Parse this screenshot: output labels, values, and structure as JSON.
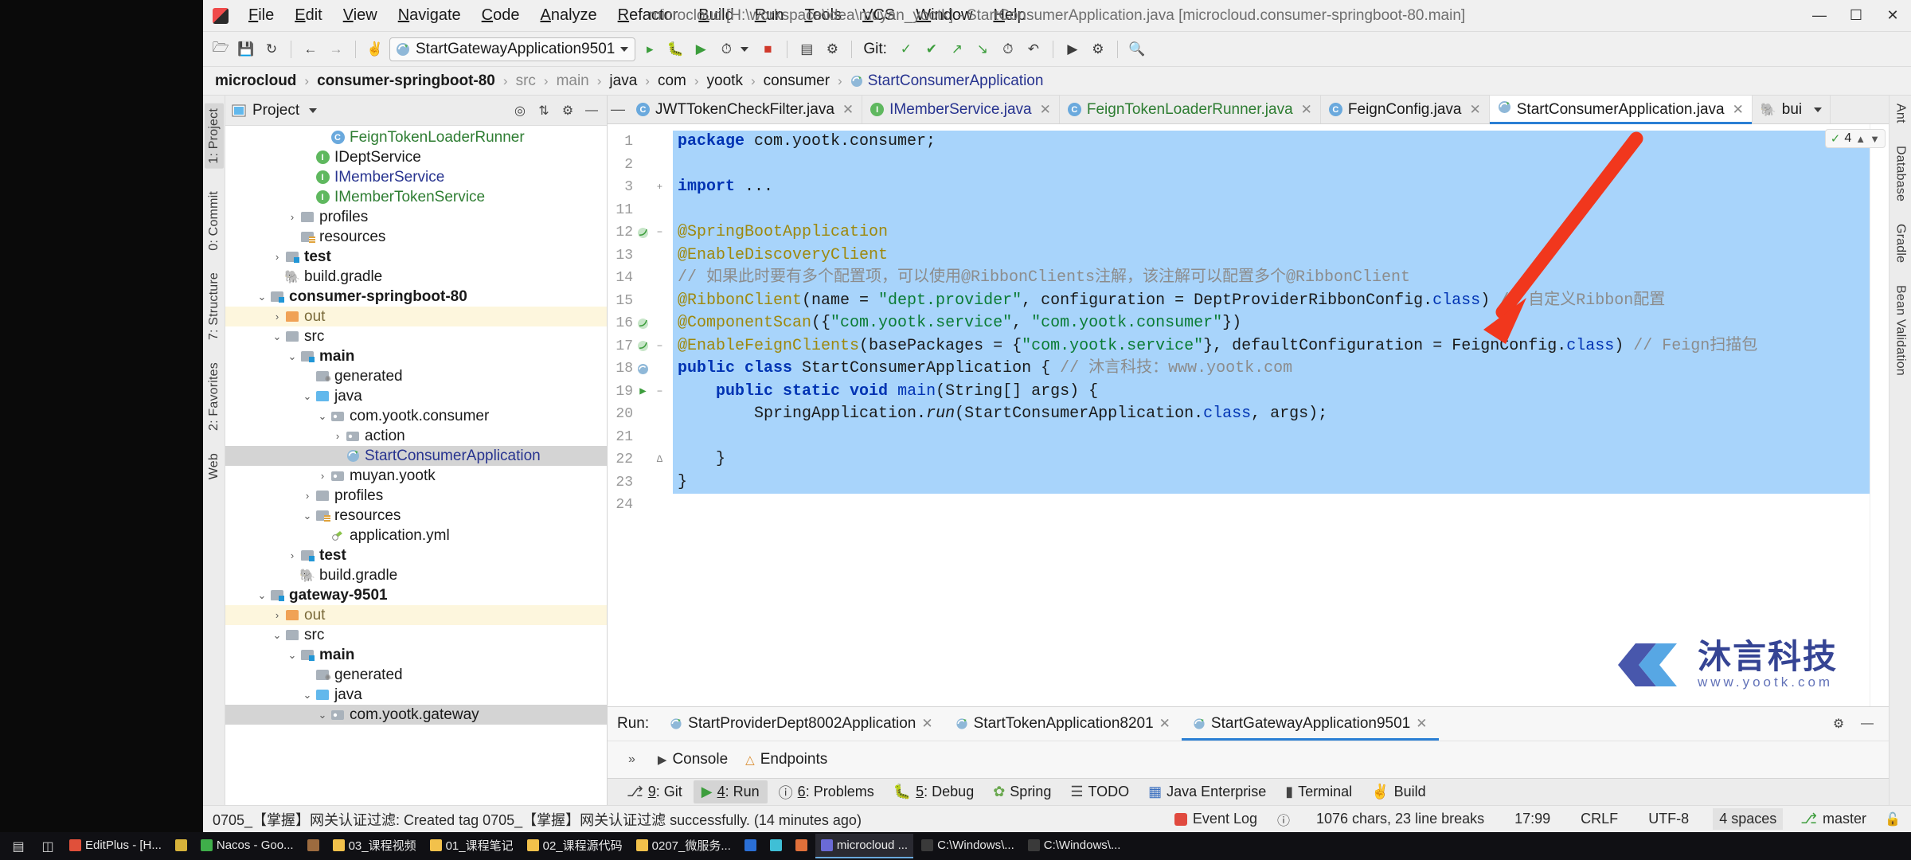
{
  "window": {
    "title": "microcloud [H:\\workspace\\idea\\muyan_yootk] - StartConsumerApplication.java [microcloud.consumer-springboot-80.main]",
    "minimize": "—",
    "maximize": "☐",
    "close": "✕",
    "app_icon": "intellij-idea-icon"
  },
  "menubar": [
    {
      "label": "File"
    },
    {
      "label": "Edit"
    },
    {
      "label": "View"
    },
    {
      "label": "Navigate"
    },
    {
      "label": "Code"
    },
    {
      "label": "Analyze"
    },
    {
      "label": "Refactor"
    },
    {
      "label": "Build"
    },
    {
      "label": "Run"
    },
    {
      "label": "Tools"
    },
    {
      "label": "VCS"
    },
    {
      "label": "Window"
    },
    {
      "label": "Help"
    }
  ],
  "toolbar": {
    "run_config": "StartGatewayApplication9501",
    "git_label": "Git:",
    "icons": [
      "open-folder-icon",
      "save-all-icon",
      "sync-icon",
      "undo-icon",
      "redo-icon",
      "build-hammer-icon",
      "run-icon",
      "debug-icon",
      "run-with-coverage-icon",
      "profile-icon",
      "stop-icon",
      "update-project-icon",
      "commit-icon",
      "push-icon",
      "history-icon",
      "rollback-icon",
      "search-everywhere-icon"
    ]
  },
  "breadcrumb": {
    "items": [
      {
        "label": "microcloud",
        "style": "bold"
      },
      {
        "label": "consumer-springboot-80",
        "style": "bold"
      },
      {
        "label": "src",
        "style": "dim"
      },
      {
        "label": "main",
        "style": "dim"
      },
      {
        "label": "java",
        "style": "normal"
      },
      {
        "label": "com",
        "style": "normal"
      },
      {
        "label": "yootk",
        "style": "normal"
      },
      {
        "label": "consumer",
        "style": "normal"
      },
      {
        "label": "StartConsumerApplication",
        "style": "class"
      }
    ]
  },
  "project_panel": {
    "title": "Project",
    "header_icons": [
      "locate-icon",
      "collapse-all-icon",
      "gear-icon",
      "hide-icon"
    ],
    "tree": [
      {
        "indent": 6,
        "arrow": "",
        "icon": "class-c",
        "label": "FeignTokenLoaderRunner",
        "color": "green",
        "state": "normal"
      },
      {
        "indent": 5,
        "arrow": "",
        "icon": "iface-i",
        "label": "IDeptService",
        "color": "dark",
        "state": "normal"
      },
      {
        "indent": 5,
        "arrow": "",
        "icon": "iface-i",
        "label": "IMemberService",
        "color": "blue",
        "state": "normal"
      },
      {
        "indent": 5,
        "arrow": "",
        "icon": "iface-i",
        "label": "IMemberTokenService",
        "color": "green",
        "state": "normal"
      },
      {
        "indent": 4,
        "arrow": "›",
        "icon": "folder-gray",
        "label": "profiles",
        "color": "dark",
        "state": "normal"
      },
      {
        "indent": 4,
        "arrow": "",
        "icon": "folder-resources",
        "label": "resources",
        "color": "dark",
        "state": "normal"
      },
      {
        "indent": 3,
        "arrow": "›",
        "icon": "folder-src",
        "label": "test",
        "color": "bold",
        "state": "normal"
      },
      {
        "indent": 3,
        "arrow": "",
        "icon": "gradle-elephant",
        "label": "build.gradle",
        "color": "dark",
        "state": "normal"
      },
      {
        "indent": 2,
        "arrow": "⌄",
        "icon": "folder-module",
        "label": "consumer-springboot-80",
        "color": "bold",
        "state": "normal"
      },
      {
        "indent": 3,
        "arrow": "›",
        "icon": "folder-orange",
        "label": "out",
        "color": "tan",
        "state": "highlight"
      },
      {
        "indent": 3,
        "arrow": "⌄",
        "icon": "folder-gray",
        "label": "src",
        "color": "dark",
        "state": "normal"
      },
      {
        "indent": 4,
        "arrow": "⌄",
        "icon": "folder-src",
        "label": "main",
        "color": "bold",
        "state": "normal"
      },
      {
        "indent": 5,
        "arrow": "",
        "icon": "folder-generated",
        "label": "generated",
        "color": "dark",
        "state": "normal"
      },
      {
        "indent": 5,
        "arrow": "⌄",
        "icon": "folder-blue",
        "label": "java",
        "color": "dark",
        "state": "normal"
      },
      {
        "indent": 6,
        "arrow": "⌄",
        "icon": "package-icon",
        "label": "com.yootk.consumer",
        "color": "dark",
        "state": "normal"
      },
      {
        "indent": 7,
        "arrow": "›",
        "icon": "package-icon",
        "label": "action",
        "color": "dark",
        "state": "normal"
      },
      {
        "indent": 7,
        "arrow": "",
        "icon": "spring-class",
        "label": "StartConsumerApplication",
        "color": "blue",
        "state": "selected"
      },
      {
        "indent": 6,
        "arrow": "›",
        "icon": "package-icon",
        "label": "muyan.yootk",
        "color": "dark",
        "state": "normal"
      },
      {
        "indent": 5,
        "arrow": "›",
        "icon": "folder-gray",
        "label": "profiles",
        "color": "dark",
        "state": "normal"
      },
      {
        "indent": 5,
        "arrow": "⌄",
        "icon": "folder-resources",
        "label": "resources",
        "color": "dark",
        "state": "normal"
      },
      {
        "indent": 6,
        "arrow": "",
        "icon": "yml-icon",
        "label": "application.yml",
        "color": "dark",
        "state": "normal"
      },
      {
        "indent": 4,
        "arrow": "›",
        "icon": "folder-src",
        "label": "test",
        "color": "bold",
        "state": "normal"
      },
      {
        "indent": 4,
        "arrow": "",
        "icon": "gradle-elephant",
        "label": "build.gradle",
        "color": "dark",
        "state": "normal"
      },
      {
        "indent": 2,
        "arrow": "⌄",
        "icon": "folder-module",
        "label": "gateway-9501",
        "color": "bold",
        "state": "normal"
      },
      {
        "indent": 3,
        "arrow": "›",
        "icon": "folder-orange",
        "label": "out",
        "color": "tan",
        "state": "highlight"
      },
      {
        "indent": 3,
        "arrow": "⌄",
        "icon": "folder-gray",
        "label": "src",
        "color": "dark",
        "state": "normal"
      },
      {
        "indent": 4,
        "arrow": "⌄",
        "icon": "folder-src",
        "label": "main",
        "color": "bold",
        "state": "normal"
      },
      {
        "indent": 5,
        "arrow": "",
        "icon": "folder-generated",
        "label": "generated",
        "color": "dark",
        "state": "normal"
      },
      {
        "indent": 5,
        "arrow": "⌄",
        "icon": "folder-blue",
        "label": "java",
        "color": "dark",
        "state": "normal"
      },
      {
        "indent": 6,
        "arrow": "⌄",
        "icon": "package-icon",
        "label": "com.yootk.gateway",
        "color": "dark",
        "state": "selected"
      }
    ]
  },
  "editor_tabs": [
    {
      "label": "JWTTokenCheckFilter.java",
      "icon": "class-c",
      "color": "dark",
      "active": false
    },
    {
      "label": "IMemberService.java",
      "icon": "iface-i",
      "color": "blue",
      "active": false
    },
    {
      "label": "FeignTokenLoaderRunner.java",
      "icon": "class-c",
      "color": "green",
      "active": false
    },
    {
      "label": "FeignConfig.java",
      "icon": "class-c",
      "color": "dark",
      "active": false
    },
    {
      "label": "StartConsumerApplication.java",
      "icon": "spring-class",
      "color": "dark",
      "active": true
    },
    {
      "label": "bui",
      "icon": "gradle-elephant",
      "color": "dark",
      "active": false
    }
  ],
  "editor": {
    "inspection_count": "4",
    "inspection_ok": "✓",
    "lines": [
      {
        "num": "1",
        "mark": "",
        "fold": "",
        "html": "<span class='kw'>package</span> com.yootk.consumer;"
      },
      {
        "num": "2",
        "mark": "",
        "fold": "",
        "html": ""
      },
      {
        "num": "3",
        "mark": "",
        "fold": "+",
        "html": "<span class='kw'>import</span> ..."
      },
      {
        "num": "11",
        "mark": "",
        "fold": "",
        "html": ""
      },
      {
        "num": "12",
        "mark": "spring-bean-icon",
        "fold": "−",
        "html": "<span class='ann'>@SpringBootApplication</span>"
      },
      {
        "num": "13",
        "mark": "",
        "fold": "",
        "html": "<span class='ann'>@EnableDiscoveryClient</span>"
      },
      {
        "num": "14",
        "mark": "",
        "fold": "",
        "html": "<span class='cmt'>// 如果此时要有多个配置项，可以使用@RibbonClients注解，该注解可以配置多个@RibbonClient</span>"
      },
      {
        "num": "15",
        "mark": "",
        "fold": "",
        "html": "<span class='ann'>@RibbonClient</span>(name = <span class='str'>\"dept.provider\"</span>, configuration = DeptProviderRibbonConfig.<span class='cls'>class</span>) <span class='cmt'>// 自定义Ribbon配置</span>"
      },
      {
        "num": "16",
        "mark": "spring-bean-icon",
        "fold": "",
        "html": "<span class='ann'>@ComponentScan</span>({<span class='str'>\"com.yootk.service\"</span>, <span class='str'>\"com.yootk.consumer\"</span>})"
      },
      {
        "num": "17",
        "mark": "spring-bean-icon",
        "fold": "−",
        "html": "<span class='ann'>@EnableFeignClients</span>(basePackages = {<span class='str'>\"com.yootk.service\"</span>}, defaultConfiguration = FeignConfig.<span class='cls'>class</span>) <span class='cmt'>// Feign扫描包</span>"
      },
      {
        "num": "18",
        "mark": "spring-run-icon",
        "fold": "",
        "html": "<span class='kw'>public class</span> StartConsumerApplication { <span class='cmt'>// 沐言科技：www.yootk.com</span>"
      },
      {
        "num": "19",
        "mark": "run-method-icon",
        "fold": "−",
        "html": "    <span class='kw'>public static void</span> <span class='cls'>main</span>(String[] args) {"
      },
      {
        "num": "20",
        "mark": "",
        "fold": "",
        "html": "        SpringApplication.<span class='itl'>run</span>(StartConsumerApplication.<span class='cls'>class</span>, args);"
      },
      {
        "num": "21",
        "mark": "",
        "fold": "",
        "html": ""
      },
      {
        "num": "22",
        "mark": "",
        "fold": "∆",
        "html": "    }"
      },
      {
        "num": "23",
        "mark": "",
        "fold": "",
        "html": "}"
      },
      {
        "num": "24",
        "mark": "",
        "fold": "",
        "html": ""
      }
    ]
  },
  "watermark": {
    "brand": "沐言科技",
    "url": "www.yootk.com"
  },
  "left_rail": [
    {
      "label": "1: Project",
      "selected": true
    },
    {
      "label": "0: Commit",
      "selected": false
    },
    {
      "label": "7: Structure",
      "selected": false
    },
    {
      "label": "2: Favorites",
      "selected": false
    },
    {
      "label": "Web",
      "selected": false
    }
  ],
  "right_rail": [
    {
      "label": "Ant"
    },
    {
      "label": "Database"
    },
    {
      "label": "Gradle"
    },
    {
      "label": "Bean Validation"
    }
  ],
  "run_panel": {
    "run_label": "Run:",
    "tabs": [
      {
        "label": "StartProviderDept8002Application",
        "active": false
      },
      {
        "label": "StartTokenApplication8201",
        "active": false
      },
      {
        "label": "StartGatewayApplication9501",
        "active": true
      }
    ],
    "subtabs": [
      {
        "label": "Console",
        "icon": "console-icon"
      },
      {
        "label": "Endpoints",
        "icon": "endpoints-icon"
      }
    ],
    "tools": [
      "gear-icon",
      "hide-icon"
    ],
    "expander": "»"
  },
  "tool_windows": [
    {
      "label": "9: Git",
      "icon": "git-branch-icon",
      "selected": false
    },
    {
      "label": "4: Run",
      "icon": "run-icon",
      "selected": true
    },
    {
      "label": "6: Problems",
      "icon": "problems-icon",
      "selected": false
    },
    {
      "label": "5: Debug",
      "icon": "debug-icon",
      "selected": false
    },
    {
      "label": "Spring",
      "icon": "spring-leaf-icon",
      "selected": false
    },
    {
      "label": "TODO",
      "icon": "todo-icon",
      "selected": false
    },
    {
      "label": "Java Enterprise",
      "icon": "javaee-icon",
      "selected": false
    },
    {
      "label": "Terminal",
      "icon": "terminal-icon",
      "selected": false
    },
    {
      "label": "Build",
      "icon": "build-hammer-icon",
      "selected": false
    }
  ],
  "status_bar": {
    "message": "0705_【掌握】网关认证过滤: Created tag 0705_【掌握】网关认证过滤 successfully. (14 minutes ago)",
    "chars": "1076 chars, 23 line breaks",
    "caret": "17:99",
    "line_sep": "CRLF",
    "encoding": "UTF-8",
    "indent": "4 spaces",
    "branch": "master",
    "event_log": "Event Log"
  },
  "taskbar": {
    "items": [
      {
        "label": "EditPlus - [H...",
        "color": "#e0503a",
        "active": false
      },
      {
        "label": "",
        "color": "#d6b23a",
        "active": false
      },
      {
        "label": "Nacos - Goo...",
        "color": "#3fae4a",
        "active": false
      },
      {
        "label": "",
        "color": "#9c6b3f",
        "active": false
      },
      {
        "label": "03_课程视频",
        "color": "#f2c14b",
        "active": false
      },
      {
        "label": "01_课程笔记",
        "color": "#f2c14b",
        "active": false
      },
      {
        "label": "02_课程源代码",
        "color": "#f2c14b",
        "active": false
      },
      {
        "label": "0207_微服务...",
        "color": "#f2c14b",
        "active": false
      },
      {
        "label": "",
        "color": "#2a6fd6",
        "active": false
      },
      {
        "label": "",
        "color": "#3fbfd6",
        "active": false
      },
      {
        "label": "",
        "color": "#e0703a",
        "active": false
      },
      {
        "label": "microcloud ...",
        "color": "#6a6ad6",
        "active": true
      },
      {
        "label": "C:\\Windows\\...",
        "color": "#3a3a3a",
        "active": false
      },
      {
        "label": "C:\\Windows\\...",
        "color": "#3a3a3a",
        "active": false
      }
    ]
  }
}
